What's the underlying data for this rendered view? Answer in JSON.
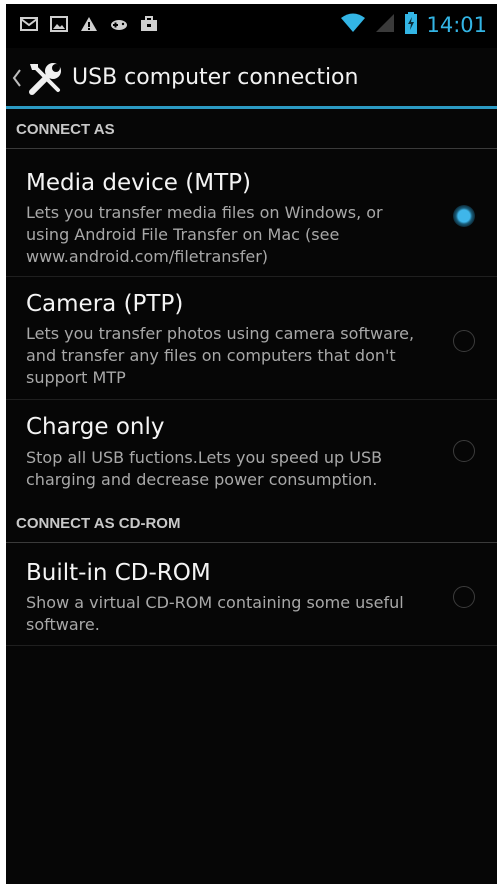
{
  "status_bar": {
    "time": "14:01",
    "left_icons": [
      "gmail-icon",
      "gallery-icon",
      "warning-icon",
      "gamepad-icon",
      "briefcase-icon"
    ],
    "right_icons": [
      "wifi-icon",
      "signal-icon",
      "battery-charging-icon"
    ],
    "accent_color": "#33b5e5"
  },
  "action_bar": {
    "title": "USB computer connection",
    "up_icon": "chevron-left-icon",
    "app_icon": "tools-icon"
  },
  "sections": {
    "connect_as": {
      "label": "CONNECT AS"
    },
    "connect_as_cdrom": {
      "label": "CONNECT AS CD-ROM"
    }
  },
  "options": {
    "mtp": {
      "title": "Media device (MTP)",
      "description": "Lets you transfer media files on Windows, or using Android File Transfer on Mac (see www.android.com/filetransfer)",
      "selected": true
    },
    "ptp": {
      "title": "Camera (PTP)",
      "description": "Lets you transfer photos using camera software, and transfer any files on computers that don't support MTP",
      "selected": false
    },
    "charge": {
      "title": "Charge only",
      "description": "Stop all USB fuctions.Lets you speed up USB charging and decrease power consumption.",
      "selected": false
    },
    "cdrom": {
      "title": "Built-in CD-ROM",
      "description": "Show a virtual CD-ROM containing some useful software.",
      "selected": false
    }
  }
}
